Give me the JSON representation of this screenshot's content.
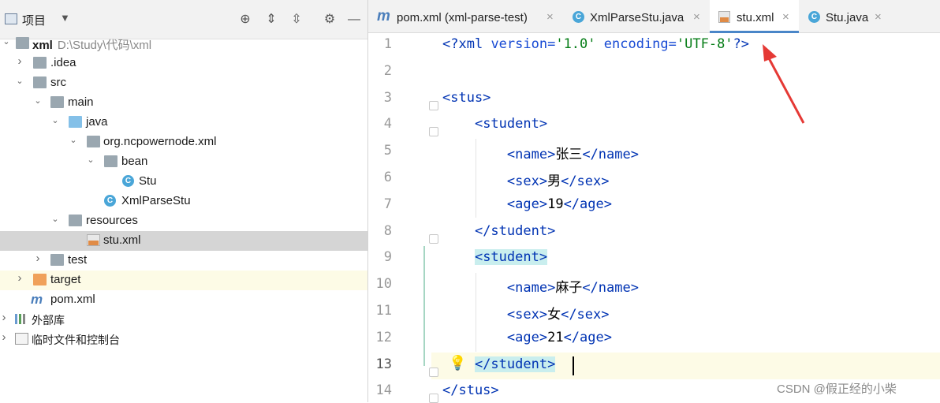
{
  "project": {
    "title": "项目",
    "tree": [
      {
        "label": "xml",
        "path": "D:\\Study\\代码\\xml",
        "arrow": "⌄",
        "bold": true
      },
      {
        "label": ".idea",
        "arrow": "›"
      },
      {
        "label": "src",
        "arrow": "⌄"
      },
      {
        "label": "main",
        "arrow": "⌄"
      },
      {
        "label": "java",
        "arrow": "⌄"
      },
      {
        "label": "org.ncpowernode.xml",
        "arrow": "⌄"
      },
      {
        "label": "bean",
        "arrow": "⌄"
      },
      {
        "label": "Stu",
        "arrow": ""
      },
      {
        "label": "XmlParseStu",
        "arrow": ""
      },
      {
        "label": "resources",
        "arrow": "⌄"
      },
      {
        "label": "stu.xml",
        "arrow": ""
      },
      {
        "label": "test",
        "arrow": "›"
      },
      {
        "label": "target",
        "arrow": "›"
      },
      {
        "label": "pom.xml",
        "arrow": ""
      },
      {
        "label": "外部库",
        "arrow": "›"
      },
      {
        "label": "临时文件和控制台",
        "arrow": "›"
      }
    ]
  },
  "tabs": [
    {
      "label": "pom.xml (xml-parse-test)",
      "close": "×"
    },
    {
      "label": "XmlParseStu.java",
      "close": "×"
    },
    {
      "label": "stu.xml",
      "close": "×"
    },
    {
      "label": "Stu.java",
      "close": "×"
    }
  ],
  "editor": {
    "line_numbers": [
      "1",
      "2",
      "3",
      "4",
      "5",
      "6",
      "7",
      "8",
      "9",
      "10",
      "11",
      "12",
      "13",
      "14"
    ],
    "lines": [
      "<?xml version='1.0' encoding='UTF-8'?>",
      "",
      "<stus>",
      "    <student>",
      "        <name>张三</name>",
      "        <sex>男</sex>",
      "        <age>19</age>",
      "    </student>",
      "    <student>",
      "        <name>麻子</name>",
      "        <sex>女</sex>",
      "        <age>21</age>",
      "    </student>",
      "</stus>"
    ],
    "current_line": 13
  },
  "watermark": "CSDN @假正经的小柴",
  "colors": {
    "accent": "#4a86c8",
    "arrow": "#e53935",
    "tag": "#0033b3",
    "value": "#067d17"
  }
}
